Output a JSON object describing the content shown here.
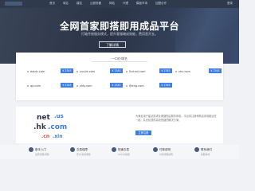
{
  "topbar": {
    "nav": [
      "首页",
      "域名",
      "建站",
      "云服务器",
      "网站",
      "代理",
      "模板市场",
      "加盟合作"
    ],
    "user": "登录"
  },
  "hero": {
    "title": "全网首家即搭即用成品平台",
    "subtitle": "打破传统服务模式，提升客服端成效能，费用直开支。",
    "cta": "了解详情"
  },
  "listing": {
    "heading": "一口价域名",
    "items": [
      {
        "domain": "baidu.com",
        "price": "¥ 2345"
      },
      {
        "domain": "yunjie.com",
        "price": "¥ 2345"
      },
      {
        "domain": "fuchan.com",
        "price": "¥ 2345"
      },
      {
        "domain": "zhu.com",
        "price": "¥ 2345"
      },
      {
        "domain": "qp.com",
        "price": "¥ 2345"
      },
      {
        "domain": "zhty.com",
        "price": "¥ 2345"
      },
      {
        "domain": "fjfeng.com",
        "price": "¥ 2345"
      }
    ]
  },
  "promo": {
    "logo_words": [
      "net",
      ".us",
      ".hk",
      ".com",
      ".cn",
      ".xin"
    ],
    "description": "为满足用户建站需求及便捷购买服务体验，平台将注册和购买体验融合在一起，并优化提供高效快捷的解决方案。",
    "button": "立即注册"
  },
  "footer": {
    "cols": [
      {
        "label": "新手入门",
        "sub": "注册流程/帮助"
      },
      {
        "label": "交易保障",
        "sub": "安全/资金保障"
      },
      {
        "label": "快速交易",
        "sub": "24小时客服"
      },
      {
        "label": "付款说明",
        "sub": "付款流程说明"
      },
      {
        "label": "联系我们",
        "sub": "客服热线"
      }
    ]
  },
  "colors": {
    "accent": "#3d7ee0",
    "hero_bg": "#2b3446",
    "topbar": "#2f3a4d"
  }
}
